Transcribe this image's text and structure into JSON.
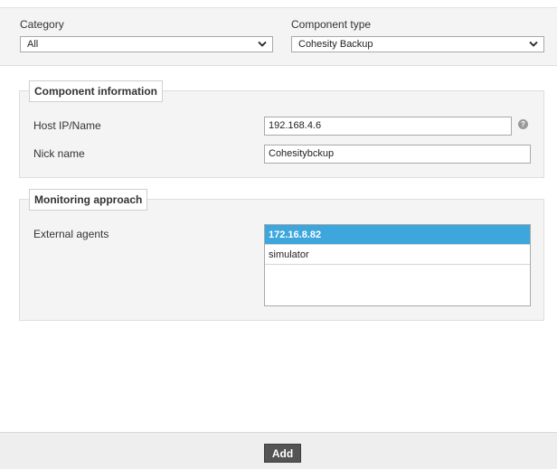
{
  "filters": {
    "category_label": "Category",
    "category_value": "All",
    "component_type_label": "Component type",
    "component_type_value": "Cohesity Backup"
  },
  "component_info": {
    "legend": "Component information",
    "host_label": "Host IP/Name",
    "host_value": "192.168.4.6",
    "nick_label": "Nick name",
    "nick_value": "Cohesitybckup"
  },
  "monitoring": {
    "legend": "Monitoring approach",
    "agents_label": "External agents",
    "agents": [
      "172.16.8.82",
      "simulator"
    ]
  },
  "footer": {
    "add_label": "Add"
  },
  "colors": {
    "selected_row": "#3da6dc",
    "add_button": "#545454"
  }
}
